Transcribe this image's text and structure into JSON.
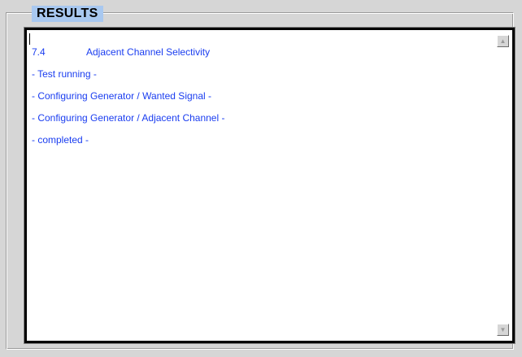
{
  "results": {
    "title": "RESULTS",
    "heading": {
      "number": "7.4",
      "text": "Adjacent Channel Selectivity"
    },
    "lines": [
      "- Test running -",
      "- Configuring Generator / Wanted Signal -",
      "- Configuring Generator / Adjacent Channel -",
      "- completed -"
    ],
    "text_color": "#1a3df0"
  },
  "scrollbar": {
    "up_icon": "arrow-up-icon",
    "down_icon": "arrow-down-icon"
  }
}
